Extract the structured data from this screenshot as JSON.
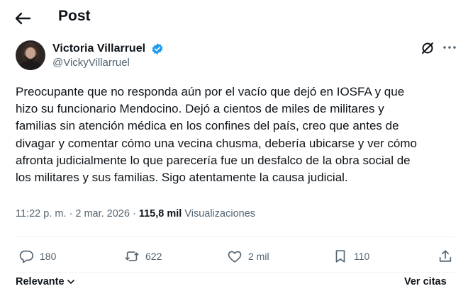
{
  "header": {
    "title": "Post",
    "back_icon": "arrow-left-icon"
  },
  "author": {
    "name": "Victoria Villarruel",
    "handle": "@VickyVillarruel",
    "verified": true,
    "verified_color": "#1d9bf0"
  },
  "post": {
    "text": "Preocupante que no responda aún por el vacío que dejó en IOSFA y que\nhizo su funcionario Mendocino. Dejó a cientos de miles de militares y\nfamilias sin atención médica en los confines del país, creo que antes de\ndivagar y comentar cómo una  vecina chusma, debería ubicarse y ver cómo\nafronta judicialmente lo que parecería fue un desfalco de la obra social de\nlos militares y sus familias. Sigo atentamente la causa judicial."
  },
  "meta": {
    "time": "11:22 p. m.",
    "separator": " · ",
    "date": "2 mar. 2026",
    "views_count": "115,8 mil",
    "views_label": "Visualizaciones"
  },
  "actions": {
    "replies": "180",
    "reposts": "622",
    "likes": "2 mil",
    "bookmarks": "110"
  },
  "footer": {
    "sort_label": "Relevante",
    "quotes_label": "Ver citas"
  },
  "colors": {
    "text": "#0f1419",
    "muted": "#536471",
    "divider": "#eff3f4"
  }
}
